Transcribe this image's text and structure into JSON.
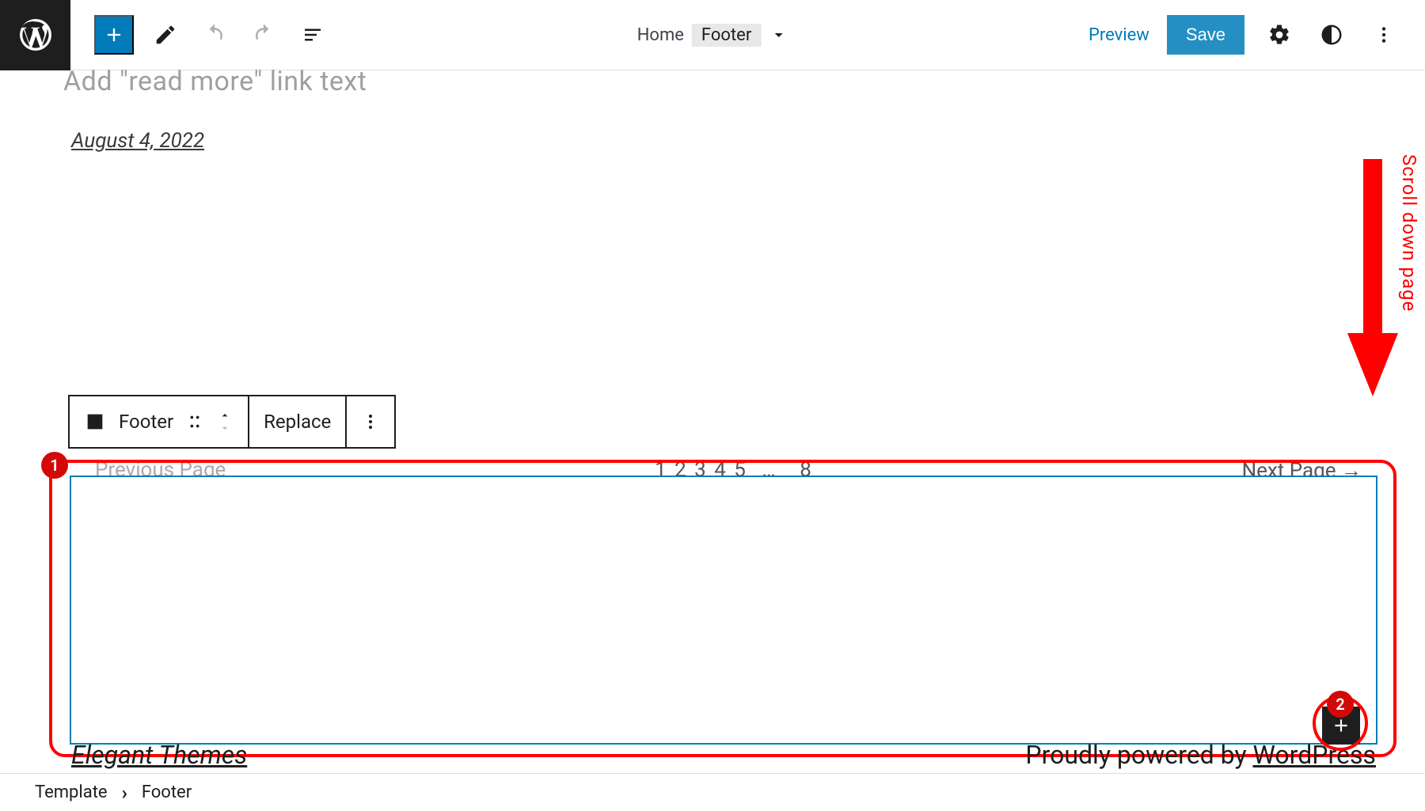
{
  "toolbar": {
    "preview_label": "Preview",
    "save_label": "Save",
    "template_name": "Home",
    "template_part_name": "Footer"
  },
  "editor": {
    "excerpt_placeholder": "Add \"read more\" link text",
    "post_date": "August 4, 2022"
  },
  "block_toolbar": {
    "part_label": "Footer",
    "replace_label": "Replace"
  },
  "pagination": {
    "prev_label": "Previous Page",
    "pages_left": "1 2 3 4 5",
    "pages_right": "8",
    "next_label": "Next Page  →"
  },
  "footer": {
    "site_title": "Elegant Themes",
    "powered_prefix": "Proudly powered by ",
    "powered_link": "WordPress"
  },
  "breadcrumb": {
    "root": "Template",
    "current": "Footer"
  },
  "annotations": {
    "scroll_label": "Scroll down page",
    "badge_1": "1",
    "badge_2": "2"
  }
}
